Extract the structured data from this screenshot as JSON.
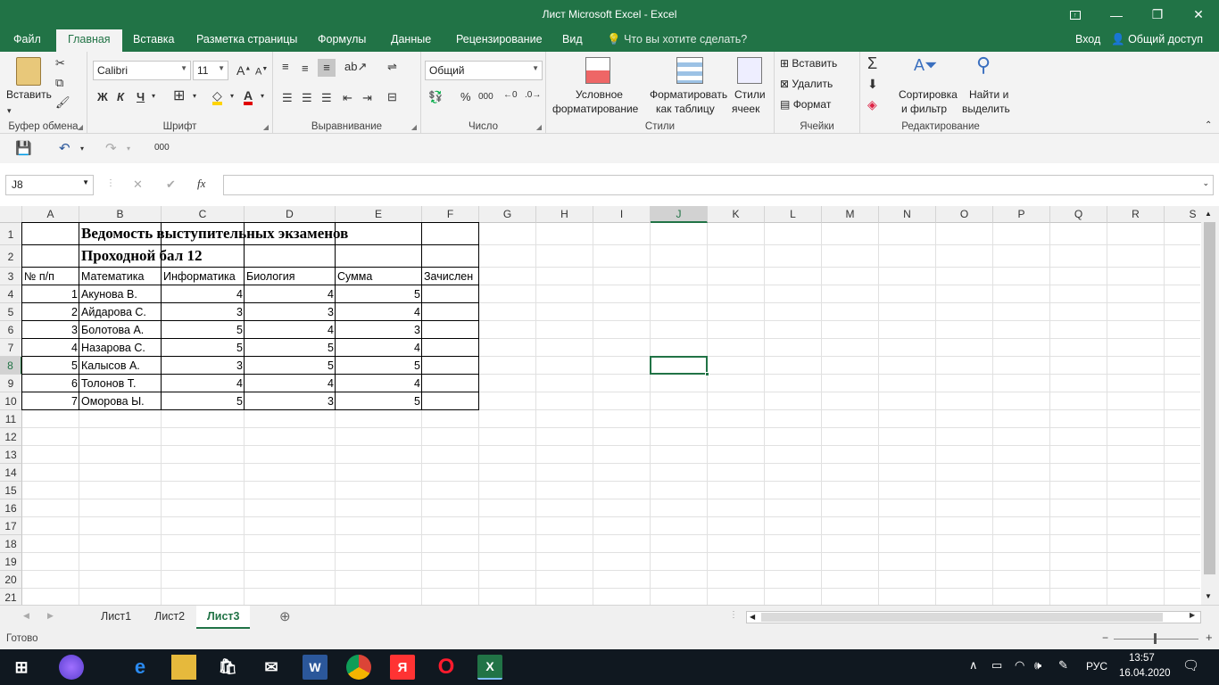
{
  "titlebar": {
    "title": "Лист Microsoft Excel - Excel",
    "ribbon_options_icon": "ribbon-display-icon",
    "minimize": "—",
    "restore": "❐",
    "close": "✕"
  },
  "ribbon_tabs": {
    "file": "Файл",
    "home": "Главная",
    "insert": "Вставка",
    "layout": "Разметка страницы",
    "formulas": "Формулы",
    "data": "Данные",
    "review": "Рецензирование",
    "view": "Вид",
    "tell": "Что вы хотите сделать?",
    "signin": "Вход",
    "share": "Общий доступ"
  },
  "clipboard": {
    "paste": "Вставить",
    "label": "Буфер обмена"
  },
  "font": {
    "name": "Calibri",
    "size": "11",
    "bold": "Ж",
    "italic": "К",
    "underline": "Ч",
    "label": "Шрифт"
  },
  "alignment": {
    "label": "Выравнивание"
  },
  "number": {
    "format": "Общий",
    "percent": "%",
    "thousands": "000",
    "label": "Число"
  },
  "styles": {
    "cond1": "Условное",
    "cond2": "форматирование",
    "table1": "Форматировать",
    "table2": "как таблицу",
    "cell1": "Стили",
    "cell2": "ячеек",
    "label": "Стили"
  },
  "cells": {
    "insert": "Вставить",
    "delete": "Удалить",
    "format": "Формат",
    "label": "Ячейки"
  },
  "editing": {
    "sort1": "Сортировка",
    "sort2": "и фильтр",
    "find1": "Найти и",
    "find2": "выделить",
    "label": "Редактирование"
  },
  "qat": {
    "extra": "000"
  },
  "formula_bar": {
    "name_box": "J8",
    "fx": "fx",
    "value": ""
  },
  "columns": [
    "A",
    "B",
    "C",
    "D",
    "E",
    "F",
    "G",
    "H",
    "I",
    "J",
    "K",
    "L",
    "M",
    "N",
    "O",
    "P",
    "Q",
    "R",
    "S"
  ],
  "rows": [
    "1",
    "2",
    "3",
    "4",
    "5",
    "6",
    "7",
    "8",
    "9",
    "10",
    "11",
    "12",
    "13",
    "14",
    "15",
    "16",
    "17",
    "18",
    "19",
    "20",
    "21"
  ],
  "sheet": {
    "b1": "Ведомость выступительных экзаменов",
    "b2": "Проходной бал 12",
    "headers": {
      "a": "№ п/п",
      "b": "Математика",
      "c": "Информатика",
      "d": "Биология",
      "e": "Сумма",
      "f": "Зачислен"
    },
    "data": [
      {
        "n": "1",
        "name": "Акунова В.",
        "c": "4",
        "d": "4",
        "e": "5"
      },
      {
        "n": "2",
        "name": "Айдарова С.",
        "c": "3",
        "d": "3",
        "e": "4"
      },
      {
        "n": "3",
        "name": "Болотова А.",
        "c": "5",
        "d": "4",
        "e": "3"
      },
      {
        "n": "4",
        "name": "Назарова С.",
        "c": "5",
        "d": "5",
        "e": "4"
      },
      {
        "n": "5",
        "name": "Калысов А.",
        "c": "3",
        "d": "5",
        "e": "5"
      },
      {
        "n": "6",
        "name": "Толонов Т.",
        "c": "4",
        "d": "4",
        "e": "4"
      },
      {
        "n": "7",
        "name": "Оморова Ы.",
        "c": "5",
        "d": "3",
        "e": "5"
      }
    ]
  },
  "sheet_tabs": [
    "Лист1",
    "Лист2",
    "Лист3"
  ],
  "status": {
    "ready": "Готово"
  },
  "taskbar": {
    "lang": "РУС",
    "time": "13:57",
    "date": "16.04.2020"
  },
  "colors": {
    "accent": "#217346",
    "selection": "#217346"
  }
}
